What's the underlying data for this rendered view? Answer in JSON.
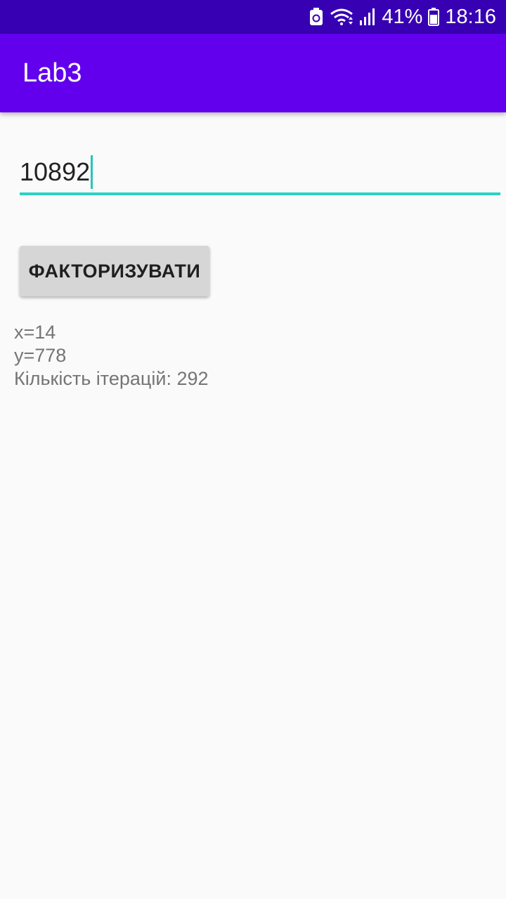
{
  "status_bar": {
    "battery_percent": "41%",
    "time": "18:16",
    "icons": [
      "battery-saver-icon",
      "wifi-icon",
      "signal-icon",
      "battery-icon"
    ]
  },
  "app_bar": {
    "title": "Lab3"
  },
  "input": {
    "value": "10892"
  },
  "button": {
    "label": "ФАКТОРИЗУВАТИ"
  },
  "result": {
    "x": "x=14",
    "y": "y=778",
    "iterations": "Кількість ітерацій: 292"
  },
  "colors": {
    "status_bar": "#3700b3",
    "app_bar": "#6200ee",
    "accent": "#2ad3c4",
    "button": "#d6d6d6",
    "background": "#fafafa"
  }
}
